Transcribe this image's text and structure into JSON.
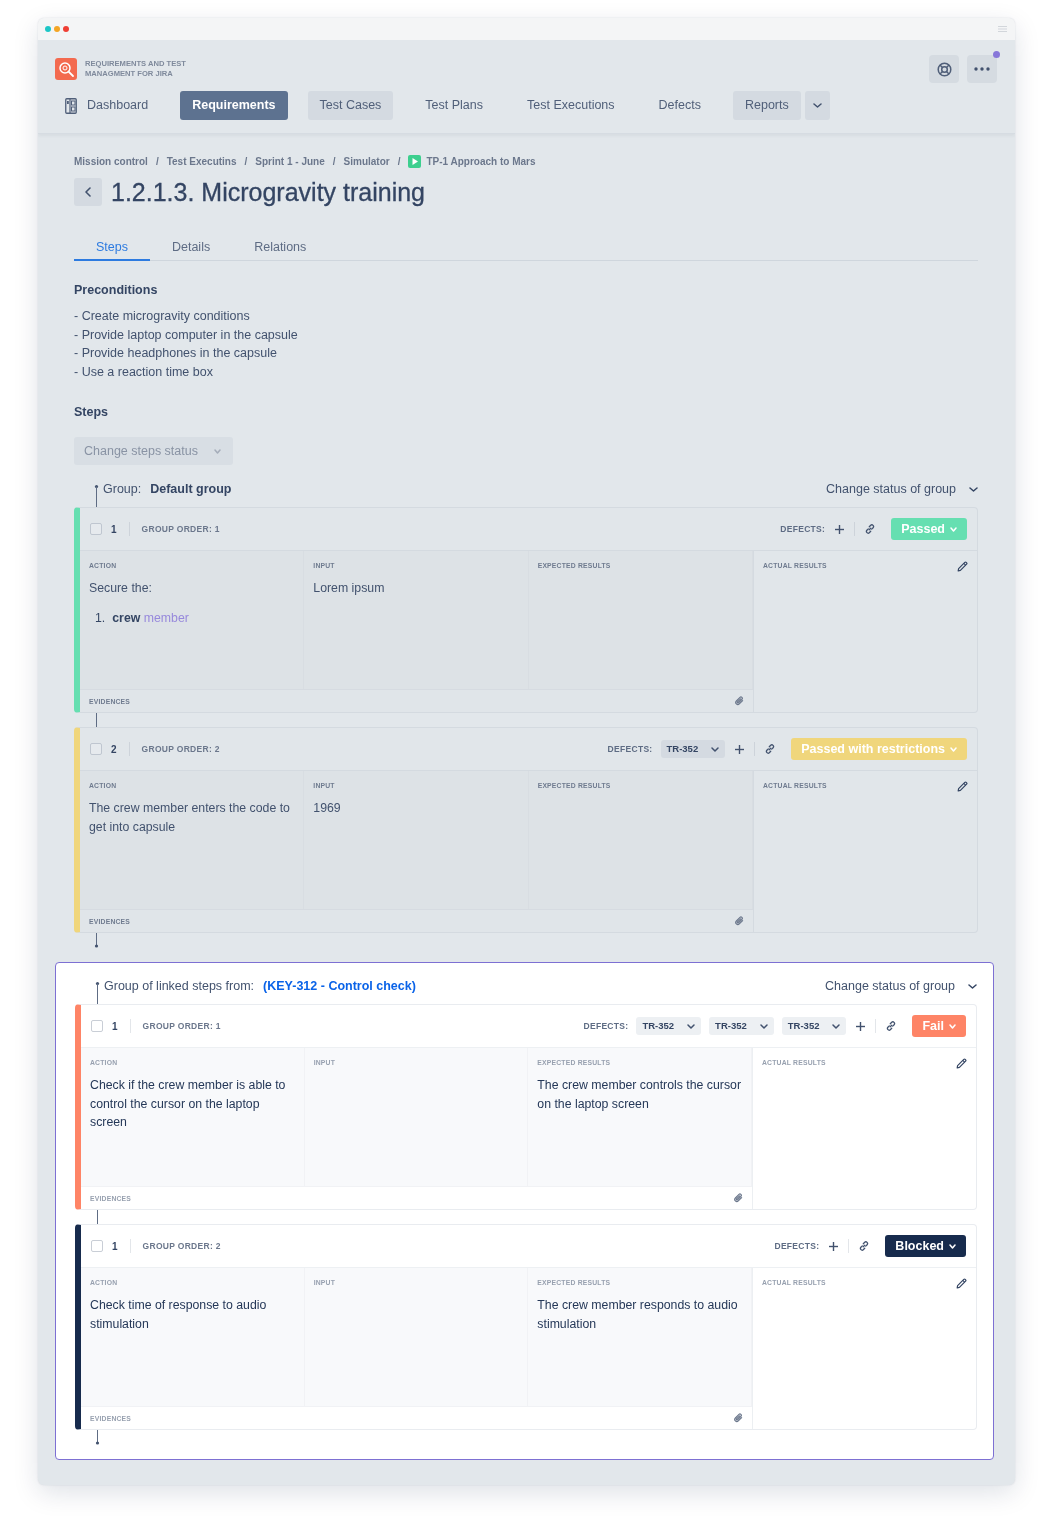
{
  "brand": {
    "lines": [
      "REQUIREMENTS AND TEST",
      "MANAGMENT FOR JIRA"
    ]
  },
  "nav": [
    {
      "label": "Dashboard",
      "kind": "icon",
      "selected": false
    },
    {
      "label": "Requirements",
      "kind": "button",
      "selected": true
    },
    {
      "label": "Test Cases",
      "kind": "button",
      "selected": false
    },
    {
      "label": "Test Plans",
      "kind": "link",
      "selected": false
    },
    {
      "label": "Test Executions",
      "kind": "link",
      "selected": false
    },
    {
      "label": "Defects",
      "kind": "link",
      "selected": false
    },
    {
      "label": "Reports",
      "kind": "menu",
      "selected": false
    }
  ],
  "breadcrumbs": [
    {
      "label": "Mission control",
      "kind": "text",
      "separator": "/"
    },
    {
      "label": "Test Executins",
      "kind": "text",
      "separator": "/"
    },
    {
      "label": "Sprint 1 - June",
      "kind": "text",
      "separator": "/"
    },
    {
      "label": "Simulator",
      "kind": "text",
      "separator": "/"
    },
    {
      "label": "TP-1 Approach to Mars",
      "kind": "plan"
    }
  ],
  "title": "1.2.1.3. Microgravity training",
  "tabs": [
    {
      "label": "Steps",
      "selected": true
    },
    {
      "label": "Details",
      "selected": false
    },
    {
      "label": "Relations",
      "selected": false
    }
  ],
  "preconditions": {
    "heading": "Preconditions",
    "lines": [
      "- Create microgravity conditions",
      "- Provide laptop computer in the capsule",
      "- Provide headphones in the capsule",
      "- Use a reaction time box"
    ]
  },
  "steps_section": {
    "heading": "Steps",
    "status_menu": {
      "label": "Change steps status",
      "disabled": true
    }
  },
  "groups": [
    {
      "label": "Group:",
      "name": "Default group",
      "kind": "default",
      "highlighted": false,
      "status_menu": "Change status of group",
      "steps": [
        {
          "number": "1",
          "checked": false,
          "order": "GROUP ORDER: 1",
          "defects_label": "DEFECTS:",
          "status": "Passed",
          "color": "#66dfb1",
          "action": {
            "label": "ACTION",
            "text": "Secure the:",
            "list": [
              {
                "number": "1.",
                "text": "**crew**",
                "link": "member"
              }
            ]
          },
          "input": {
            "label": "INPUT",
            "text": "Lorem ipsum"
          },
          "expected": {
            "label": "EXPECTED RESULTS"
          },
          "actual": {
            "label": "ACTUAL RESULTS"
          },
          "evidences_label": "EVIDENCES"
        },
        {
          "number": "2",
          "checked": false,
          "order": "GROUP ORDER: 2",
          "defects_label": "DEFECTS:",
          "defects": [
            "TR-352"
          ],
          "status": "Passed with restrictions",
          "color": "#f0d67c",
          "action": {
            "label": "ACTION",
            "text": "The crew member enters the code to get into capsule"
          },
          "input": {
            "label": "INPUT",
            "text": "1969"
          },
          "expected": {
            "label": "EXPECTED RESULTS"
          },
          "actual": {
            "label": "ACTUAL RESULTS"
          },
          "evidences_label": "EVIDENCES"
        }
      ]
    },
    {
      "label": "Group of linked steps from:",
      "name": "(KEY-312 - Control check)",
      "kind": "linked",
      "highlighted": true,
      "status_menu": "Change status of group",
      "steps": [
        {
          "number": "1",
          "checked": false,
          "order": "GROUP ORDER: 1",
          "defects_label": "DEFECTS:",
          "defects": [
            "TR-352",
            "TR-352",
            "TR-352"
          ],
          "status": "Fail",
          "color": "#fe8466",
          "action": {
            "label": "ACTION",
            "text": "Check if the crew member is able to control the cursor on the laptop screen"
          },
          "input": {
            "label": "INPUT"
          },
          "expected": {
            "label": "EXPECTED RESULTS",
            "text": "The crew member controls the cursor on the laptop screen"
          },
          "actual": {
            "label": "ACTUAL RESULTS"
          },
          "evidences_label": "EVIDENCES"
        },
        {
          "number": "1",
          "checked": false,
          "order": "GROUP ORDER: 2",
          "defects_label": "DEFECTS:",
          "status": "Blocked",
          "color": "#172b4d",
          "action": {
            "label": "ACTION",
            "text": "Check time of response to audio stimulation"
          },
          "input": {
            "label": "INPUT"
          },
          "expected": {
            "label": "EXPECTED RESULTS",
            "text": "The crew member responds to audio stimulation"
          },
          "actual": {
            "label": "ACTUAL RESULTS"
          },
          "evidences_label": "EVIDENCES"
        }
      ]
    }
  ]
}
